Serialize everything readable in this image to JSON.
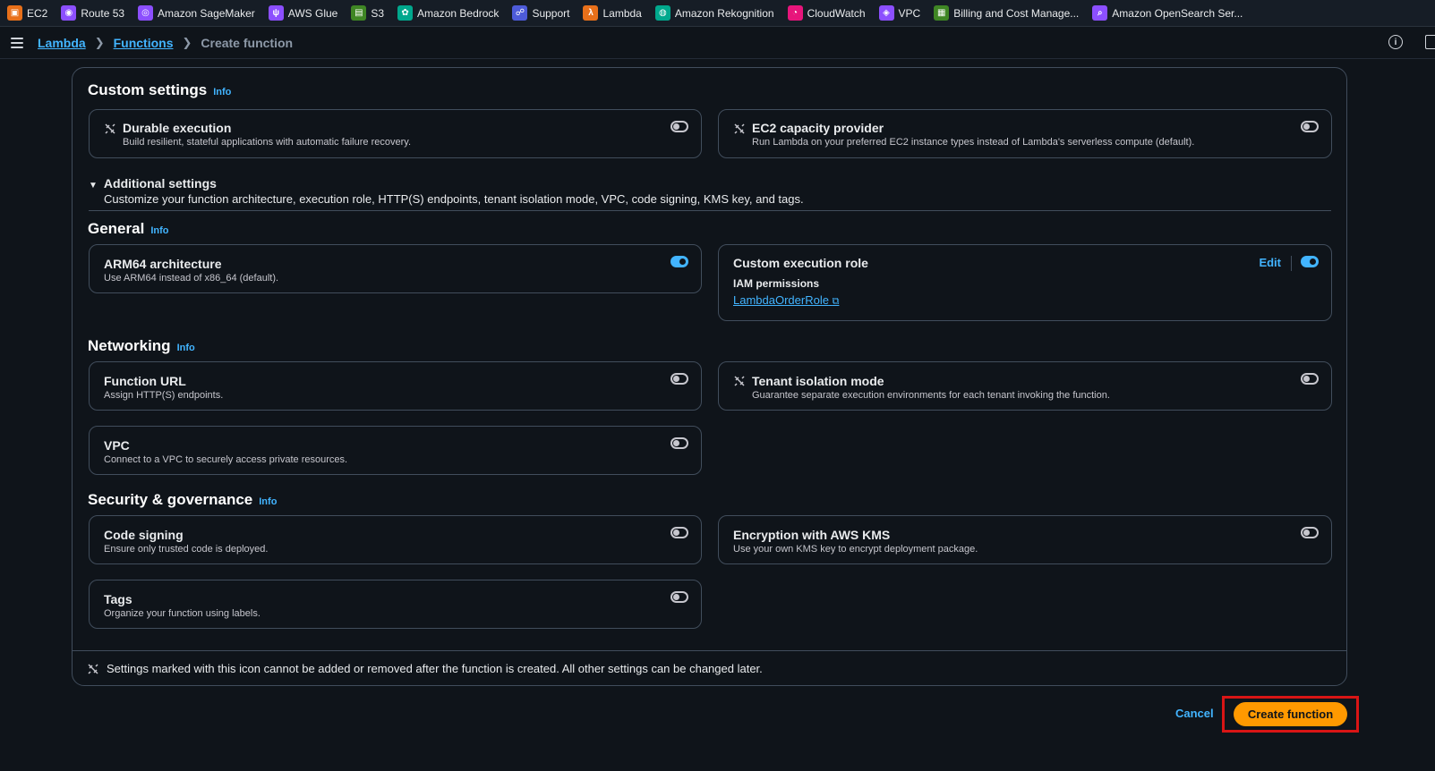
{
  "favorites": [
    {
      "label": "EC2",
      "color": "#e8701a",
      "glyph": "▣"
    },
    {
      "label": "Route 53",
      "color": "#8c4fff",
      "glyph": "◉"
    },
    {
      "label": "Amazon SageMaker",
      "color": "#8c4fff",
      "glyph": "◎"
    },
    {
      "label": "AWS Glue",
      "color": "#8c4fff",
      "glyph": "ψ"
    },
    {
      "label": "S3",
      "color": "#3f8624",
      "glyph": "▤"
    },
    {
      "label": "Amazon Bedrock",
      "color": "#01a88d",
      "glyph": "✿"
    },
    {
      "label": "Support",
      "color": "#4d5bd9",
      "glyph": "☍"
    },
    {
      "label": "Lambda",
      "color": "#e8701a",
      "glyph": "λ"
    },
    {
      "label": "Amazon Rekognition",
      "color": "#01a88d",
      "glyph": "◍"
    },
    {
      "label": "CloudWatch",
      "color": "#e7157b",
      "glyph": "◔"
    },
    {
      "label": "VPC",
      "color": "#8c4fff",
      "glyph": "◈"
    },
    {
      "label": "Billing and Cost Manage...",
      "color": "#3f8624",
      "glyph": "▦"
    },
    {
      "label": "Amazon OpenSearch Ser...",
      "color": "#8c4fff",
      "glyph": "⌕"
    }
  ],
  "breadcrumb": {
    "items": [
      "Lambda",
      "Functions"
    ],
    "current": "Create function"
  },
  "custom_settings": {
    "title": "Custom settings",
    "info": "Info",
    "durable": {
      "title": "Durable execution",
      "desc": "Build resilient, stateful applications with automatic failure recovery.",
      "enabled": false
    },
    "ec2": {
      "title": "EC2 capacity provider",
      "desc": "Run Lambda on your preferred EC2 instance types instead of Lambda's serverless compute (default).",
      "enabled": false
    }
  },
  "additional": {
    "title": "Additional settings",
    "desc": "Customize your function architecture, execution role, HTTP(S) endpoints, tenant isolation mode, VPC, code signing, KMS key, and tags."
  },
  "general": {
    "title": "General",
    "info": "Info",
    "arm": {
      "title": "ARM64 architecture",
      "desc": "Use ARM64 instead of x86_64 (default).",
      "enabled": true
    },
    "role": {
      "title": "Custom execution role",
      "edit": "Edit",
      "iam_label": "IAM permissions",
      "role_name": "LambdaOrderRole",
      "enabled": true
    }
  },
  "networking": {
    "title": "Networking",
    "info": "Info",
    "url": {
      "title": "Function URL",
      "desc": "Assign HTTP(S) endpoints.",
      "enabled": false
    },
    "tenant": {
      "title": "Tenant isolation mode",
      "desc": "Guarantee separate execution environments for each tenant invoking the function.",
      "enabled": false
    },
    "vpc": {
      "title": "VPC",
      "desc": "Connect to a VPC to securely access private resources.",
      "enabled": false
    }
  },
  "security": {
    "title": "Security & governance",
    "info": "Info",
    "codesign": {
      "title": "Code signing",
      "desc": "Ensure only trusted code is deployed.",
      "enabled": false
    },
    "kms": {
      "title": "Encryption with AWS KMS",
      "desc": "Use your own KMS key to encrypt deployment package.",
      "enabled": false
    },
    "tags": {
      "title": "Tags",
      "desc": "Organize your function using labels.",
      "enabled": false
    }
  },
  "footer_note": "Settings marked with this icon cannot be added or removed after the function is created. All other settings can be changed later.",
  "actions": {
    "cancel": "Cancel",
    "create": "Create function"
  }
}
